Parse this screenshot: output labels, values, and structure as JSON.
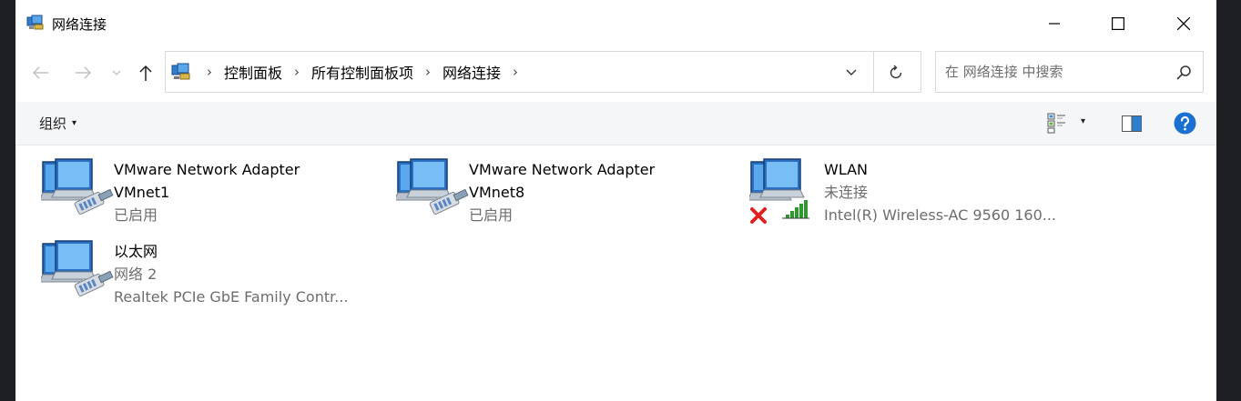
{
  "window": {
    "title": "网络连接",
    "controls": [
      "minimize-icon",
      "maximize-icon",
      "close-icon"
    ]
  },
  "nav": {
    "breadcrumb": [
      "控制面板",
      "所有控制面板项",
      "网络连接"
    ]
  },
  "search": {
    "placeholder": "在 网络连接 中搜索"
  },
  "commandbar": {
    "organize_label": "组织",
    "organize_caret": "▾",
    "view_caret": "▾"
  },
  "adapters": [
    {
      "name_line1": "VMware Network Adapter",
      "name_line2": "VMnet1",
      "status": "已启用"
    },
    {
      "name_line1": "VMware Network Adapter",
      "name_line2": "VMnet8",
      "status": "已启用"
    },
    {
      "name_line1": "WLAN",
      "status": "未连接",
      "device": "Intel(R) Wireless-AC 9560 160..."
    },
    {
      "name_line1": "以太网",
      "status": "网络 2",
      "device": "Realtek PCIe GbE Family Contr..."
    }
  ],
  "colors": {
    "accent_blue": "#0063b1",
    "help_blue": "#1a6fd0",
    "error_red": "#e02020",
    "signal_green": "#2e9a2e",
    "secondary_text": "#6d6d6d"
  }
}
